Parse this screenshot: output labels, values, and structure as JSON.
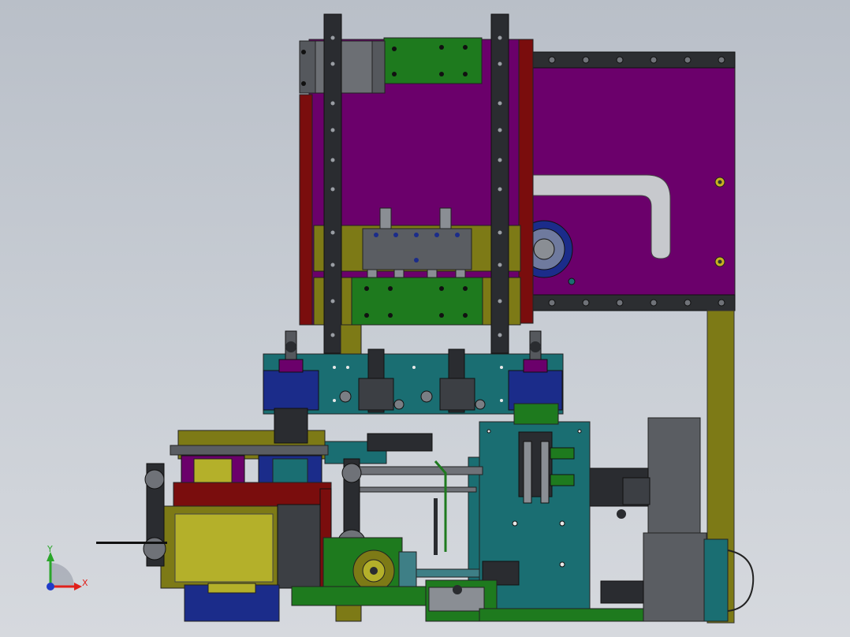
{
  "viewport": {
    "title": "",
    "background_top": "#b9bfc8",
    "background_bottom": "#d6d9de"
  },
  "triad": {
    "x_label": "X",
    "y_label": "Y",
    "x_color": "#e0201b",
    "y_color": "#2aa62a",
    "z_color": "#1f3bc8"
  },
  "palette": {
    "purple": "#6b006b",
    "green": "#1e7a1e",
    "olive": "#7d7a16",
    "teal": "#1a6e72",
    "navy": "#1b2c8a",
    "darkred": "#7a0d0d",
    "gray": "#5a5d62",
    "dark": "#2a2c30",
    "steel": "#8a8e94",
    "yellow": "#b4b02a"
  }
}
